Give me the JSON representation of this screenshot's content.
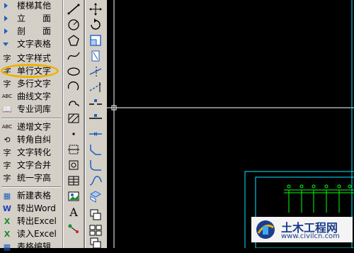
{
  "menu": {
    "items": [
      {
        "label": "楼梯其他",
        "icon": "expand-triangle-icon"
      },
      {
        "label": "立　　面",
        "icon": "expand-triangle-icon"
      },
      {
        "label": "剖　　面",
        "icon": "expand-triangle-icon"
      },
      {
        "label": "文字表格",
        "icon": "collapse-triangle-icon"
      },
      {
        "label": "文字样式",
        "icon_text": "字"
      },
      {
        "label": "单行文字",
        "icon_text": "字"
      },
      {
        "label": "多行文字",
        "icon_text": "字"
      },
      {
        "label": "曲线文字",
        "icon_text": "ABC"
      },
      {
        "label": "专业词库",
        "icon_text": "📖"
      },
      {
        "label": "递增文字",
        "icon_text": "ABC"
      },
      {
        "label": "转角自纠",
        "icon_text": "⟲"
      },
      {
        "label": "文字转化",
        "icon_text": "字"
      },
      {
        "label": "文字合并",
        "icon_text": "字"
      },
      {
        "label": "统一字高",
        "icon_text": "字"
      },
      {
        "label": "新建表格",
        "icon_text": "▦"
      },
      {
        "label": "转出Word",
        "icon_text": "W"
      },
      {
        "label": "转出Excel",
        "icon_text": "X"
      },
      {
        "label": "读入Excel",
        "icon_text": "X"
      },
      {
        "label": "表格编辑",
        "icon_text": "▦"
      }
    ],
    "highlight_color": "#f0b000"
  },
  "watermark": {
    "title": "土木工程网",
    "url": "www.civilcn.com"
  },
  "colors": {
    "panel": "#d4d0c8",
    "canvas": "#000000",
    "cad_lines": "#00e5ff",
    "cad_green": "#00ff00"
  }
}
